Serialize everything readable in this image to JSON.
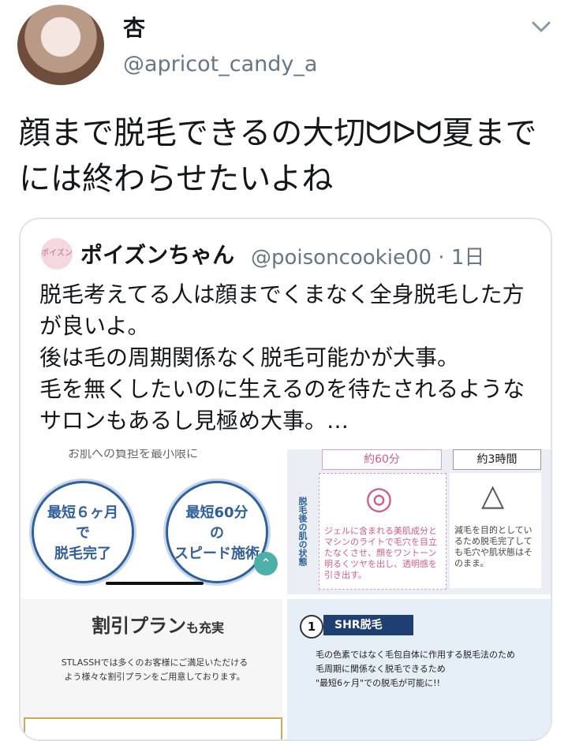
{
  "header": {
    "display_name": "杏",
    "handle": "@apricot_candy_a"
  },
  "tweet": {
    "text": "顔まで脱毛できるの大切ᗢᐅᗢ夏までには終わらせたいよね"
  },
  "quote": {
    "avatar_text": "ポイズン",
    "name": "ポイズンちゃん",
    "handle": "@poisoncookie00 · 1日",
    "text": "脱毛考えてる人は顔までくまなく全身脱毛した方が良いよ。\n後は毛の周期関係なく脱毛可能かが大事。\n毛を無くしたいのに生えるのを待たされるようなサロンもあるし見極め大事。…"
  },
  "media": {
    "p1": {
      "top_text": "お肌への負担を最小限に",
      "circle1": "最短６ヶ月で脱毛完了",
      "circle1_lines": [
        "最短６ヶ月",
        "で",
        "脱毛完了"
      ],
      "circle2_lines": [
        "最短60分",
        "の",
        "スピード施術"
      ]
    },
    "p2": {
      "time1": "約60分",
      "time2": "約3時間",
      "side_label": "脱毛後の肌の状態",
      "left_desc": "ジェルに含まれる美肌成分とマシンのライトで毛穴を目立たなくさせ、顔をワントーン明るくツヤを出し、透明感を引き出す。",
      "right_desc": "減毛を目的としているため脱毛完了しても毛穴や肌状態はそのまま。",
      "circle_symbol": "◎",
      "triangle_symbol": "△"
    },
    "p3": {
      "title_main": "割引プラン",
      "title_small": "も充実",
      "desc": "STLASSHでは多くのお客様にご満足いただけるよう様々な割引プランをご用意しております。"
    },
    "p4": {
      "number": "1",
      "tag": "SHR脱毛",
      "line1": "毛の色素ではなく毛包自体に作用する脱毛法のため",
      "line2": "毛周期に関係なく脱毛できるため",
      "line3": "\"最短6ヶ月\"での脱毛が可能に!!"
    }
  },
  "colors": {
    "accent": "#2f5f9c",
    "muted": "#657786",
    "pink": "#d05c82"
  }
}
